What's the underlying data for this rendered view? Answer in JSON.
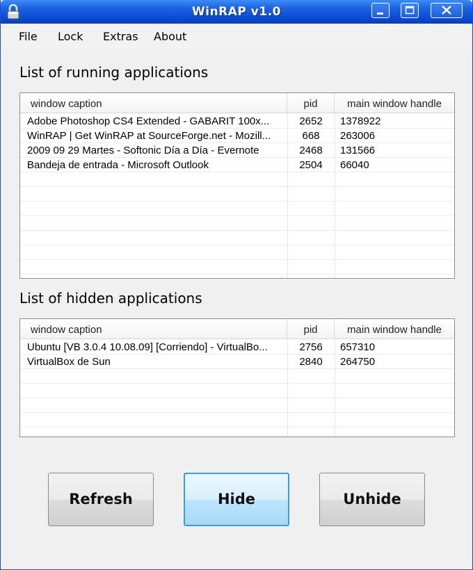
{
  "window": {
    "title": "WinRAP v1.0"
  },
  "menu": [
    {
      "label": "File"
    },
    {
      "label": "Lock"
    },
    {
      "label": "Extras"
    },
    {
      "label": "About"
    }
  ],
  "running": {
    "title": "List of running applications",
    "columns": [
      "window caption",
      "pid",
      "main window handle"
    ],
    "rows": [
      {
        "caption": "Adobe Photoshop CS4 Extended - GABARIT 100x...",
        "pid": "2652",
        "handle": "1378922"
      },
      {
        "caption": "WinRAP | Get WinRAP at SourceForge.net - Mozill...",
        "pid": "668",
        "handle": "263006"
      },
      {
        "caption": "2009 09 29 Martes - Softonic Día a Día - Evernote",
        "pid": "2468",
        "handle": "131566"
      },
      {
        "caption": "Bandeja de entrada - Microsoft Outlook",
        "pid": "2504",
        "handle": "66040"
      }
    ]
  },
  "hidden": {
    "title": "List of hidden applications",
    "columns": [
      "window caption",
      "pid",
      "main window handle"
    ],
    "rows": [
      {
        "caption": "Ubuntu [VB 3.0.4 10.08.09] [Corriendo] - VirtualBo...",
        "pid": "2756",
        "handle": "657310"
      },
      {
        "caption": "VirtualBox de Sun",
        "pid": "2840",
        "handle": "264750"
      }
    ]
  },
  "buttons": {
    "refresh": "Refresh",
    "hide": "Hide",
    "unhide": "Unhide"
  },
  "icons": {
    "app": "lock-icon",
    "minimize": "minimize-icon",
    "maximize": "maximize-icon",
    "close": "close-icon"
  },
  "colors": {
    "titlebar": "#0a4fd6",
    "focus_border": "#3d9be0"
  }
}
